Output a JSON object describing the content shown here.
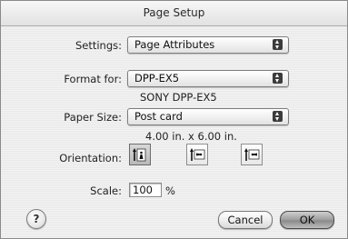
{
  "window": {
    "title": "Page Setup"
  },
  "settings": {
    "label": "Settings:",
    "value": "Page Attributes"
  },
  "format_for": {
    "label": "Format for:",
    "value": "DPP-EX5",
    "printer_name": "SONY DPP-EX5"
  },
  "paper_size": {
    "label": "Paper Size:",
    "value": "Post card",
    "dimensions": "4.00 in. x 6.00 in."
  },
  "orientation": {
    "label": "Orientation:",
    "options": [
      {
        "name": "portrait",
        "selected": true
      },
      {
        "name": "landscape",
        "selected": false
      },
      {
        "name": "reverse-landscape",
        "selected": false
      }
    ]
  },
  "scale": {
    "label": "Scale:",
    "value": "100",
    "unit": "%"
  },
  "buttons": {
    "help": "?",
    "cancel": "Cancel",
    "ok": "OK"
  },
  "icons": {
    "popup": "up-down-arrows-icon",
    "help": "question-mark-icon",
    "orientation": [
      "portrait-orientation-icon",
      "landscape-orientation-icon",
      "reverse-landscape-orientation-icon"
    ]
  }
}
